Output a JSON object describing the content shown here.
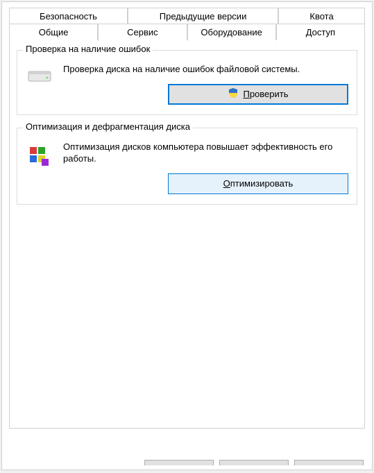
{
  "tabs": {
    "row1": [
      {
        "label": "Безопасность"
      },
      {
        "label": "Предыдущие версии"
      },
      {
        "label": "Квота"
      }
    ],
    "row2": [
      {
        "label": "Общие"
      },
      {
        "label": "Сервис",
        "active": true
      },
      {
        "label": "Оборудование"
      },
      {
        "label": "Доступ"
      }
    ]
  },
  "group_check": {
    "legend": "Проверка на наличие ошибок",
    "text": "Проверка диска на наличие ошибок файловой системы.",
    "button_prefix": "",
    "button_mnemonic": "П",
    "button_suffix": "роверить"
  },
  "group_optimize": {
    "legend": "Оптимизация и дефрагментация диска",
    "text": "Оптимизация дисков компьютера повышает эффективность его работы.",
    "button_prefix": "",
    "button_mnemonic": "О",
    "button_suffix": "птимизировать"
  }
}
